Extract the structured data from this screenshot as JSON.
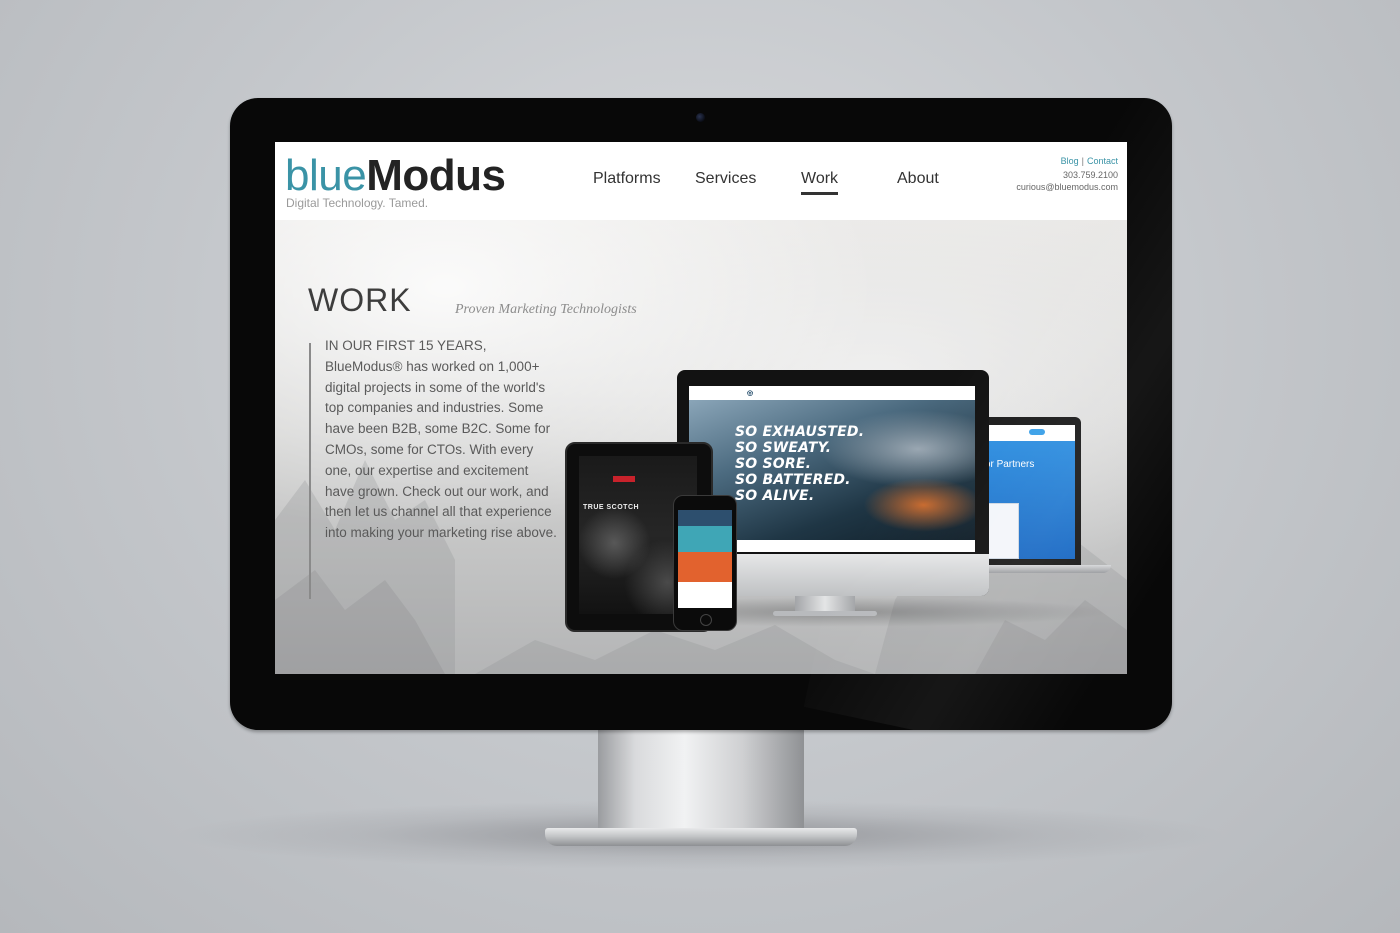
{
  "header": {
    "logo_blue": "blue",
    "logo_modus": "Modus",
    "tagline": "Digital Technology. Tamed.",
    "nav": [
      {
        "label": "Platforms"
      },
      {
        "label": "Services"
      },
      {
        "label": "Work",
        "active": true
      },
      {
        "label": "About"
      }
    ],
    "util_links": {
      "blog": "Blog",
      "separator": "|",
      "contact": "Contact"
    },
    "phone": "303.759.2100",
    "email": "curious@bluemodus.com"
  },
  "hero": {
    "title": "WORK",
    "subtitle": "Proven Marketing Technologists",
    "body": "IN OUR FIRST 15 YEARS, BlueModus® has worked on 1,000+ digital projects in some of the world's top companies and industries. Some have been B2B, some B2C. Some for CMOs, some for CTOs. With every one, our expertise and excitement have grown. Check out our work, and then let us channel all that experience into making your marketing rise above."
  },
  "devices": {
    "monitor_headline": [
      "SO EXHAUSTED.",
      "SO SWEATY.",
      "SO SORE.",
      "SO BATTERED.",
      "SO ALIVE."
    ],
    "laptop_text": "nt for Partners",
    "tablet_text": "TRUE SCOTCH"
  },
  "colors": {
    "brand_blue": "#3a93a6",
    "brand_dark": "#232323",
    "bezel": "#080808"
  }
}
